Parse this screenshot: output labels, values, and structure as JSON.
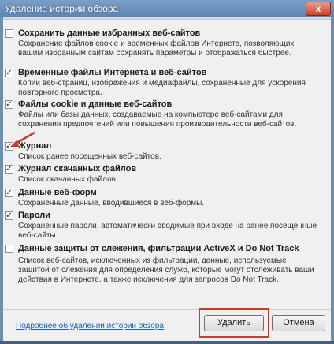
{
  "window": {
    "title": "Удаление истории обзора",
    "close_glyph": "x"
  },
  "options": [
    {
      "label": "Сохранить данные избранных веб-сайтов",
      "description": "Сохранение файлов cookie и временных файлов Интернета, позволяющих вашим избранным сайтам сохранять параметры и отображаться быстрее.",
      "checked": false
    },
    {
      "label": "Временные файлы Интернета и веб-сайтов",
      "description": "Копии веб-страниц, изображения и медиафайлы, сохраненные для ускорения повторного просмотра.",
      "checked": true
    },
    {
      "label": "Файлы cookie и данные веб-сайтов",
      "description": "Файлы или базы данных, создаваемые на компьютере веб-сайтами для сохранения предпочтений или повышения производительности веб-сайтов.",
      "checked": true
    },
    {
      "label": "Журнал",
      "description": "Список ранее посещенных веб-сайтов.",
      "checked": true
    },
    {
      "label": "Журнал скачанных файлов",
      "description": "Список скачанных файлов.",
      "checked": true
    },
    {
      "label": "Данные веб-форм",
      "description": "Сохраненные данные, вводившиеся в веб-формы.",
      "checked": true
    },
    {
      "label": "Пароли",
      "description": "Сохраненные пароли, автоматически вводимые при входе на ранее посещенные веб-сайты.",
      "checked": true
    },
    {
      "label": "Данные защиты от слежения, фильтрации ActiveX и Do Not Track",
      "description": "Список веб-сайтов, исключенных из фильтрации, данные, используемые защитой от слежения для определения служб, которые могут отслеживать ваши действия в Интернете, а также исключения для запросов Do Not Track.",
      "checked": false
    }
  ],
  "check_glyph": "✓",
  "footer": {
    "link": "Подробнее об удалении истории обзора",
    "delete_button": "Удалить",
    "cancel_button": "Отмена"
  },
  "colors": {
    "highlight": "#c83c2a",
    "link": "#1f5fb8"
  }
}
